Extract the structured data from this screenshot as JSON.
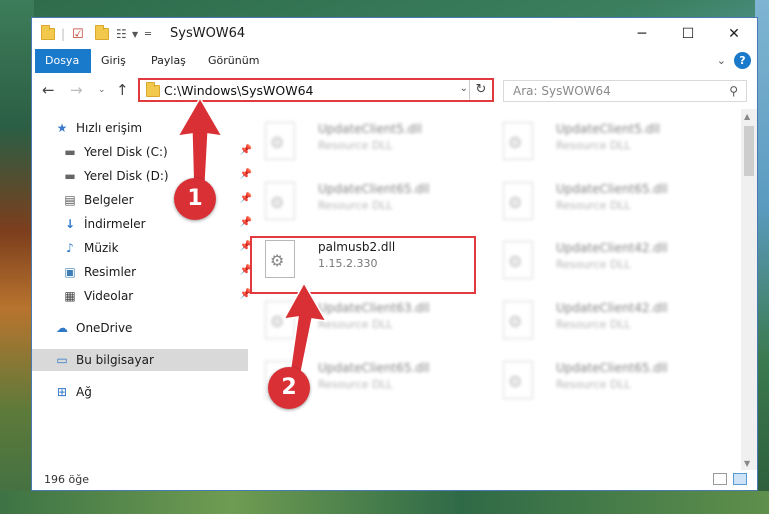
{
  "window": {
    "title": "SysWOW64",
    "minimize": "─",
    "maximize": "☐",
    "close": "✕"
  },
  "ribbon": {
    "tabs": [
      "Dosya",
      "Giriş",
      "Paylaş",
      "Görünüm"
    ],
    "active_tab": "Dosya",
    "help": "?"
  },
  "address_bar": {
    "path": "C:\\Windows\\SysWOW64"
  },
  "search": {
    "placeholder": "Ara: SysWOW64"
  },
  "sidebar": {
    "items": [
      {
        "label": "Hızlı erişim",
        "icon": "star-icon"
      },
      {
        "label": "Yerel Disk (C:)",
        "icon": "drive-icon",
        "pinned": true
      },
      {
        "label": "Yerel Disk (D:)",
        "icon": "drive-icon",
        "pinned": true
      },
      {
        "label": "Belgeler",
        "icon": "documents-icon",
        "pinned": true
      },
      {
        "label": "İndirmeler",
        "icon": "download-icon",
        "pinned": true
      },
      {
        "label": "Müzik",
        "icon": "music-icon",
        "pinned": true
      },
      {
        "label": "Resimler",
        "icon": "pictures-icon",
        "pinned": true
      },
      {
        "label": "Videolar",
        "icon": "videos-icon",
        "pinned": true
      },
      {
        "label": "OneDrive",
        "icon": "onedrive-icon"
      },
      {
        "label": "Bu bilgisayar",
        "icon": "computer-icon",
        "selected": true
      },
      {
        "label": "Ağ",
        "icon": "network-icon"
      }
    ]
  },
  "files": {
    "left": [
      {
        "name": "UpdateClient5.dll",
        "desc": "Resource DLL"
      },
      {
        "name": "UpdateClient65.dll",
        "desc": "Resource DLL"
      },
      {
        "name": "palmusb2.dll",
        "desc": "1.15.2.330"
      },
      {
        "name": "UpdateClient63.dll",
        "desc": "Resource DLL"
      },
      {
        "name": "UpdateClient65.dll",
        "desc": "Resource DLL"
      }
    ],
    "right": [
      {
        "name": "UpdateClient5.dll",
        "desc": "Resource DLL"
      },
      {
        "name": "UpdateClient65.dll",
        "desc": "Resource DLL"
      },
      {
        "name": "UpdateClient42.dll",
        "desc": "Resource DLL"
      },
      {
        "name": "UpdateClient42.dll",
        "desc": "Resource DLL"
      },
      {
        "name": "UpdateClient65.dll",
        "desc": "Resource DLL"
      }
    ]
  },
  "status": {
    "count": "196 öğe"
  },
  "annotations": {
    "badge1": "1",
    "badge2": "2",
    "color": "#d93036"
  }
}
